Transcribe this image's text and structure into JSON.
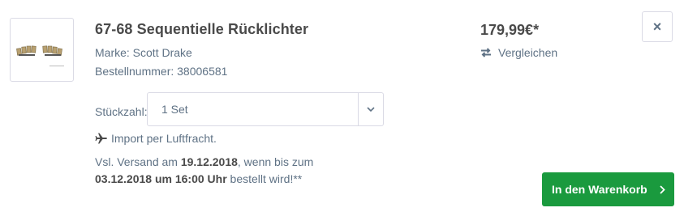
{
  "product": {
    "image_alt": "Sequentielle Rücklichter Produktbild",
    "title": "67-68 Sequentielle Rücklichter",
    "brand_label": "Marke: Scott Drake",
    "order_number_label": "Bestellnummer: 38006581",
    "price": "179,99€*"
  },
  "actions": {
    "compare_label": "Vergleichen",
    "close_label": "×",
    "cart_label": "In den Warenkorb"
  },
  "quantity": {
    "label": "Stückzahl:",
    "selected": "1 Set"
  },
  "shipping": {
    "import_note": "Import per Luftfracht.",
    "line1_prefix": "Vsl. Versand am ",
    "ship_date": "19.12.2018",
    "line1_suffix": ", wenn bis zum",
    "deadline": "03.12.2018 um 16:00 Uhr",
    "line2_suffix": " bestellt wird!**"
  },
  "colors": {
    "primary_button": "#1a9a3e",
    "text_muted": "#5f7285",
    "text_strong": "#4a4a4a",
    "border": "#dadae5"
  },
  "icons": {
    "compare": "arrows-swap-icon",
    "airplane": "airplane-icon",
    "chevron_down": "chevron-down-icon",
    "chevron_right": "chevron-right-icon",
    "close": "close-icon"
  }
}
